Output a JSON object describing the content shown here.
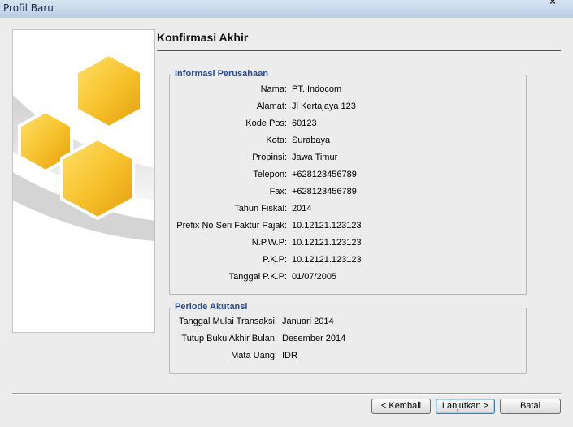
{
  "window": {
    "title": "Profil Baru"
  },
  "page": {
    "heading": "Konfirmasi Akhir"
  },
  "company": {
    "legend": "Informasi Perusahaan",
    "rows": [
      {
        "label": "Nama:",
        "value": "PT. Indocom"
      },
      {
        "label": "Alamat:",
        "value": "Jl Kertajaya 123"
      },
      {
        "label": "Kode Pos:",
        "value": "60123"
      },
      {
        "label": "Kota:",
        "value": "Surabaya"
      },
      {
        "label": "Propinsi:",
        "value": "Jawa Timur"
      },
      {
        "label": "Telepon:",
        "value": "+628123456789"
      },
      {
        "label": "Fax:",
        "value": "+628123456789"
      },
      {
        "label": "Tahun Fiskal:",
        "value": "2014"
      },
      {
        "label": "Prefix No Seri Faktur Pajak:",
        "value": "10.12121.123123"
      },
      {
        "label": "N.P.W.P:",
        "value": "10.12121.123123"
      },
      {
        "label": "P.K.P:",
        "value": "10.12121.123123"
      },
      {
        "label": "Tanggal P.K.P:",
        "value": "01/07/2005"
      }
    ]
  },
  "period": {
    "legend": "Periode Akutansi",
    "rows": [
      {
        "label": "Tanggal Mulai Transaksi:",
        "value": "Januari 2014"
      },
      {
        "label": "Tutup Buku Akhir Bulan:",
        "value": "Desember 2014"
      },
      {
        "label": "Mata Uang:",
        "value": "IDR"
      }
    ]
  },
  "buttons": {
    "back": "< Kembali",
    "next": "Lanjutkan >",
    "cancel": "Batal"
  },
  "colors": {
    "legend": "#2a4d8f",
    "hex_primary": "#f2b21a",
    "hex_light": "#ffd84d"
  },
  "icons": {
    "close": "close-icon",
    "graphic": "honeycomb-graphic"
  }
}
